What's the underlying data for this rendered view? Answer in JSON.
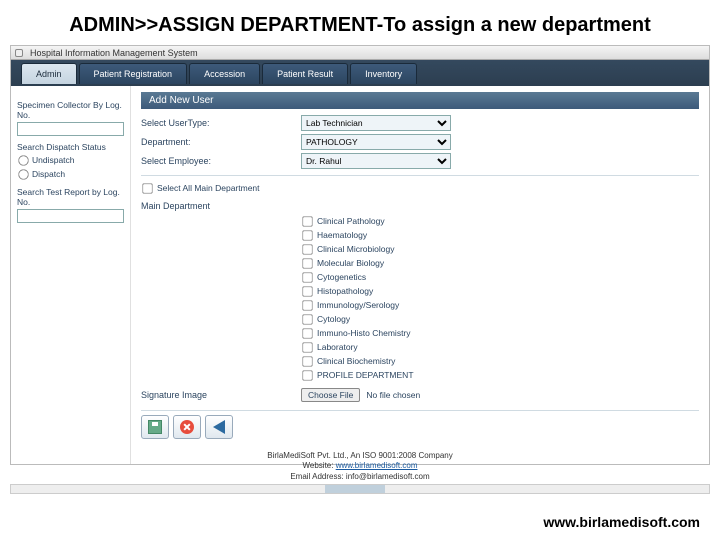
{
  "slide": {
    "title": "ADMIN>>ASSIGN DEPARTMENT-To assign a new department"
  },
  "window": {
    "title": "Hospital Information Management System"
  },
  "tabs": {
    "admin": "Admin",
    "patient_reg": "Patient Registration",
    "accession": "Accession",
    "patient_result": "Patient Result",
    "inventory": "Inventory"
  },
  "sidebar": {
    "specimen_label": "Specimen Collector By Log. No.",
    "dispatch_group_label": "Search Dispatch Status",
    "radio_undispatch": "Undispatch",
    "radio_dispatch": "Dispatch",
    "search_report_label": "Search Test Report by Log. No."
  },
  "main": {
    "section_title": "Add New User",
    "user_type_label": "Select UserType:",
    "user_type_value": "Lab Technician",
    "dept_label": "Department:",
    "dept_value": "PATHOLOGY",
    "emp_label": "Select Employee:",
    "emp_value": "Dr. Rahul",
    "select_all_label": "Select All Main Department",
    "main_dept_label": "Main Department",
    "departments": [
      "Clinical Pathology",
      "Haematology",
      "Clinical Microbiology",
      "Molecular Biology",
      "Cytogenetics",
      "Histopathology",
      "Immunology/Serology",
      "Cytology",
      "Immuno-Histo Chemistry",
      "Laboratory",
      "Clinical Biochemistry",
      "PROFILE DEPARTMENT"
    ],
    "signature_label": "Signature Image",
    "file_button": "Choose File",
    "file_status": "No file chosen"
  },
  "footer": {
    "line1": "BirlaMediSoft Pvt. Ltd., An ISO 9001:2008 Company",
    "line2a": "Website: ",
    "link": "www.birlamedisoft.com",
    "line3": "Email Address: info@birlamedisoft.com"
  },
  "bottom_url": "www.birlamedisoft.com"
}
